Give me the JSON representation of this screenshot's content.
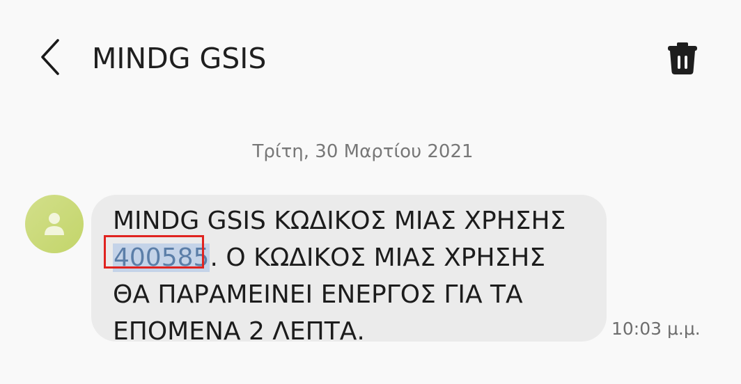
{
  "header": {
    "title": "MINDG GSIS",
    "back_icon": "chevron-left-icon",
    "delete_icon": "trash-icon"
  },
  "conversation": {
    "date": "Τρίτη, 30 Μαρτίου 2021"
  },
  "message": {
    "avatar_icon": "person-icon",
    "avatar_color": "#cbdc77",
    "line1": "MINDG GSIS ΚΩΔΙΚΟΣ ΜΙΑΣ ΧΡΗΣΗΣ",
    "code": "400585",
    "line2_rest": ". Ο ΚΩΔΙΚΟΣ ΜΙΑΣ ΧΡΗΣΗΣ",
    "line3": "ΘΑ ΠΑΡΑΜΕΙΝΕΙ ΕΝΕΡΓΟΣ ΓΙΑ ΤΑ",
    "line4": "ΕΠΟΜΕΝΑ 2 ΛΕΠΤΑ.",
    "time": "10:03 μ.μ.",
    "highlight_color": "#e0231f"
  }
}
